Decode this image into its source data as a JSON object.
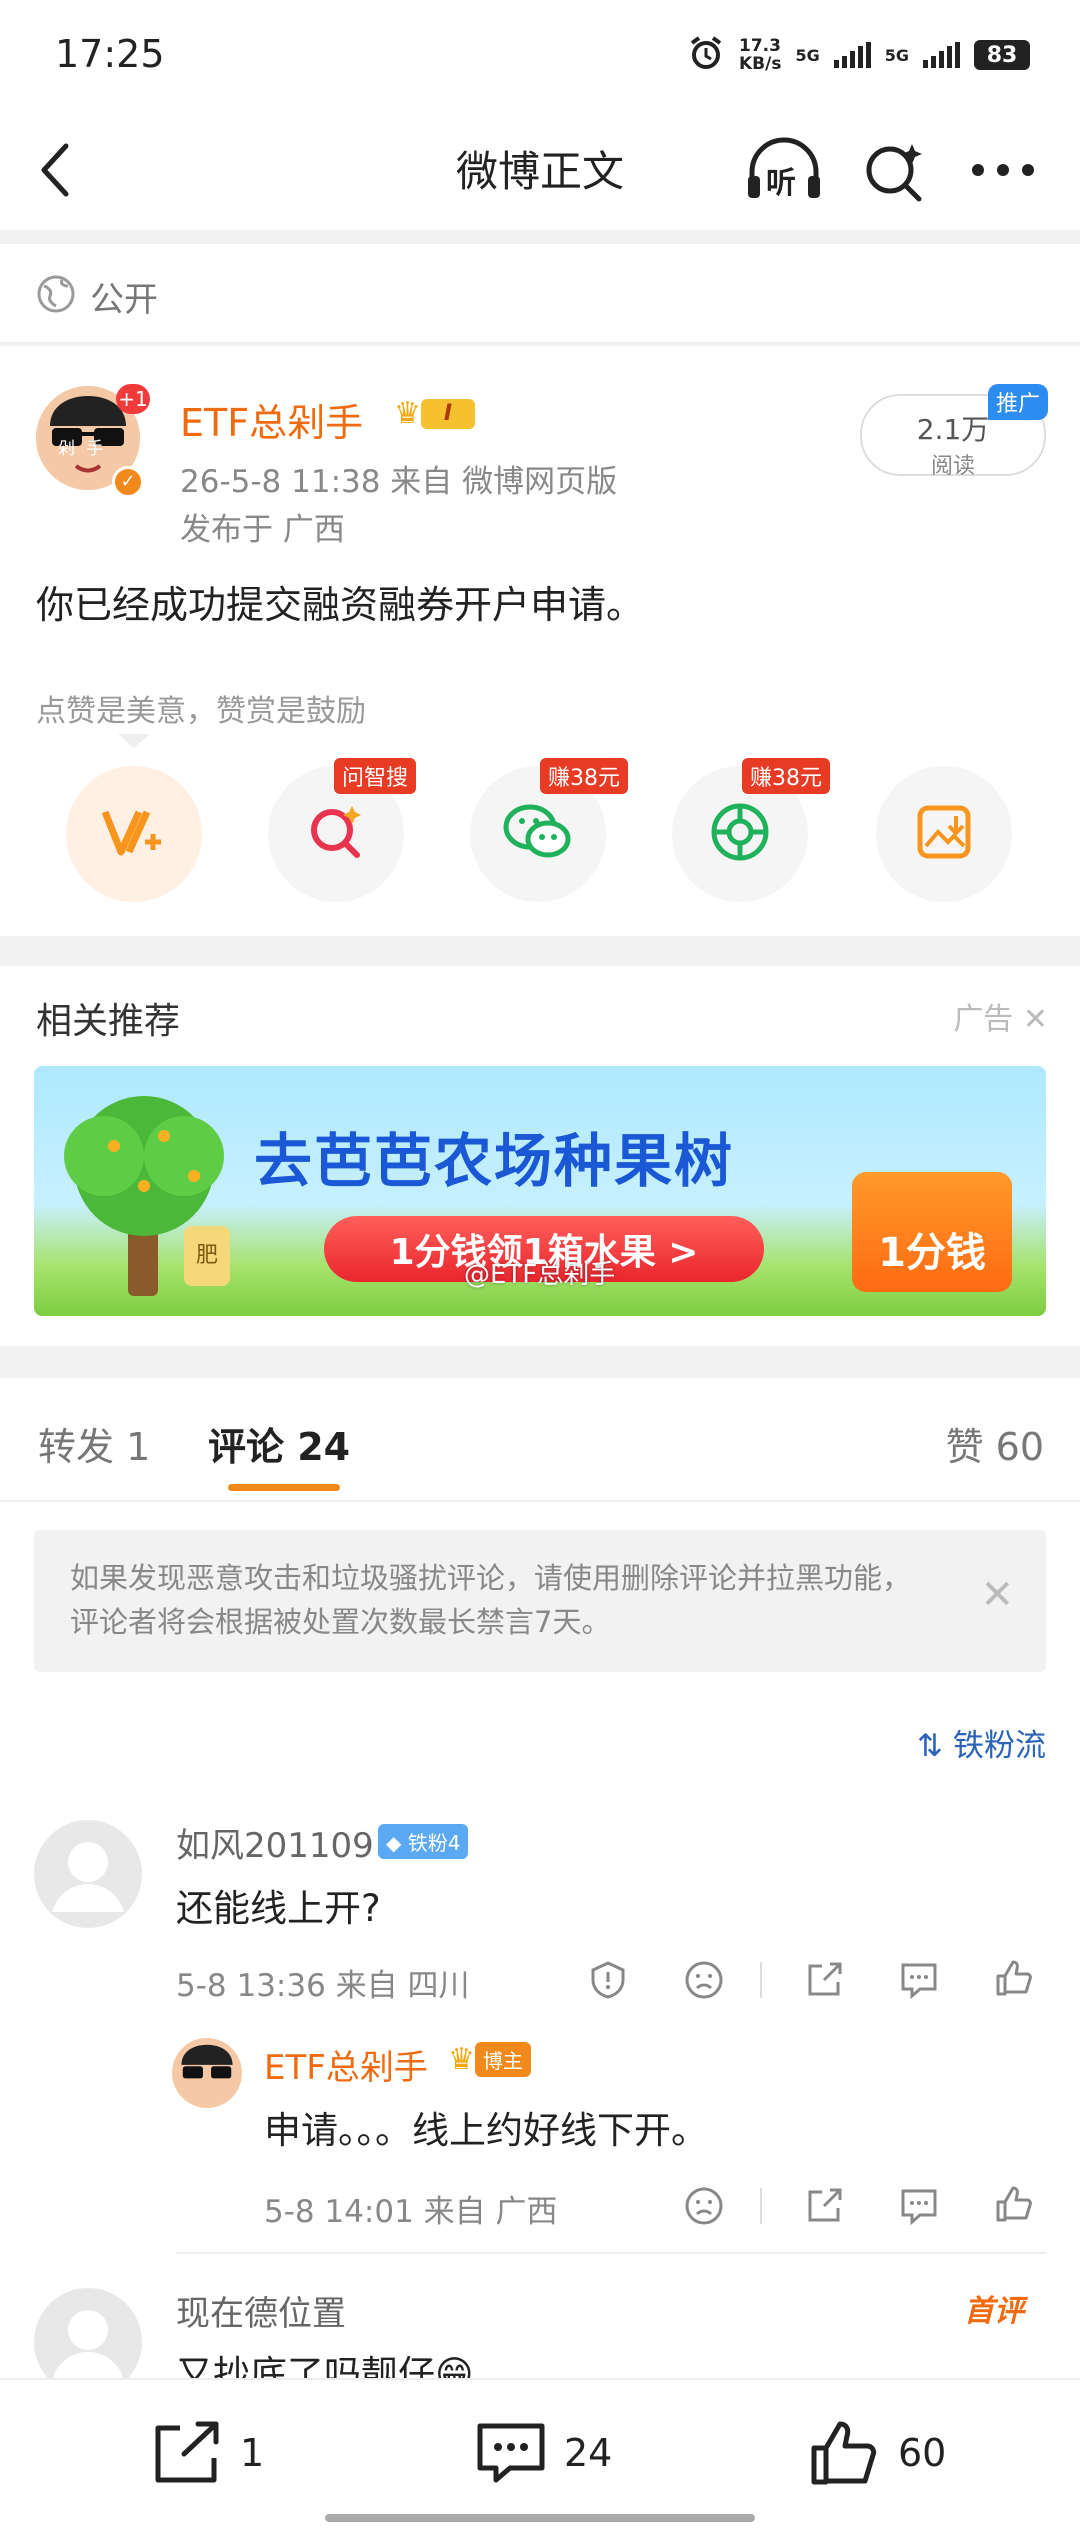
{
  "status_bar": {
    "time": "17:25",
    "speed": "17.3",
    "speed_unit": "KB/s",
    "net1": "5G",
    "net2": "5G",
    "battery": "83"
  },
  "nav": {
    "title": "微博正文",
    "listen_label": "听"
  },
  "visibility": {
    "label": "公开"
  },
  "post": {
    "username": "ETF总剁手",
    "level_badge": "I",
    "avatar_badge": "+1",
    "avatar_caption": "剁 手",
    "meta": "26-5-8 11:38  来自 微博网页版",
    "location": "发布于 广西",
    "body": "你已经成功提交融资融券开户申请。",
    "reads": "2.1万",
    "reads_label": "阅读",
    "promo_tag": "推广",
    "cheer_text": "点赞是美意，赞赏是鼓励",
    "actions": [
      {
        "name": "reward",
        "badge": ""
      },
      {
        "name": "ask-zhisou",
        "badge": "问智搜"
      },
      {
        "name": "wechat",
        "badge": "赚38元"
      },
      {
        "name": "moments",
        "badge": "赚38元"
      },
      {
        "name": "save-image",
        "badge": ""
      }
    ]
  },
  "recommend": {
    "title": "相关推荐",
    "ad_label": "广告",
    "banner_headline": "去芭芭农场种果树",
    "banner_button": "1分钱领1箱水果 >",
    "banner_box": "1分钱",
    "banner_watermark": "@ETF总剁手",
    "banner_pot": "肥"
  },
  "tabs": {
    "repost": "转发 1",
    "comments": "评论 24",
    "likes": "赞 60"
  },
  "notice": {
    "text": "如果发现恶意攻击和垃圾骚扰评论，请使用删除评论并拉黑功能，评论者将会根据被处置次数最长禁言7天。"
  },
  "sort": {
    "label": "铁粉流"
  },
  "comments": [
    {
      "user": "如风201109",
      "fan_badge": "铁粉4",
      "text": "还能线上开?",
      "meta": "5-8 13:36  来自 四川"
    },
    {
      "user": "ETF总剁手",
      "role_badge": "博主",
      "text": "申请。。。线上约好线下开。",
      "meta": "5-8 14:01  来自 广西"
    },
    {
      "user": "现在德位置",
      "tag": "首评",
      "text": "又抄底了吗靓仔😁"
    }
  ],
  "bottom_bar": {
    "repost": "1",
    "comment": "24",
    "like": "60"
  },
  "colors": {
    "accent_orange": "#f06b10",
    "link_blue": "#2b63b8",
    "badge_red": "#e83b24"
  }
}
